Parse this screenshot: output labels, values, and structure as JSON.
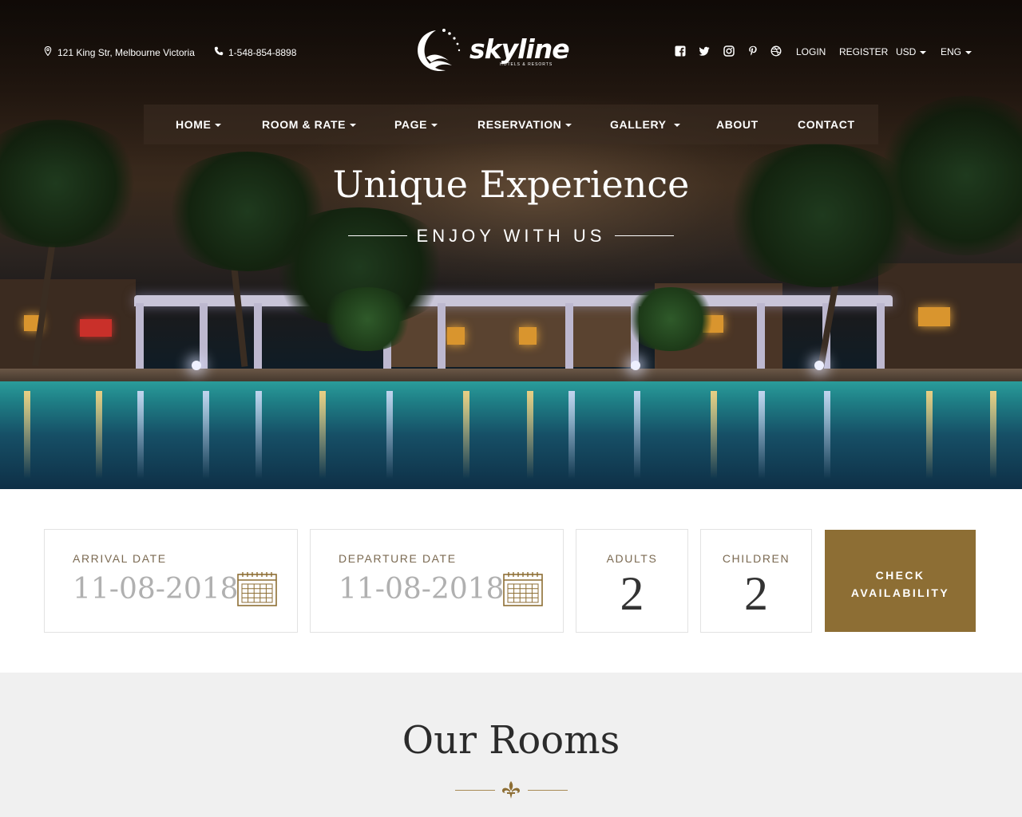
{
  "header": {
    "address": "121 King Str, Melbourne Victoria",
    "phone": "1-548-854-8898",
    "logo_text": "skyline",
    "logo_tagline": "HOTELS & RESORTS",
    "social_icons": [
      "facebook-icon",
      "twitter-icon",
      "instagram-icon",
      "pinterest-icon",
      "dribbble-icon"
    ],
    "login": "LOGIN",
    "register": "REGISTER",
    "currency": "USD",
    "language": "ENG"
  },
  "nav": {
    "items": [
      {
        "label": "HOME",
        "dropdown": true
      },
      {
        "label": "ROOM & RATE",
        "dropdown": true
      },
      {
        "label": "PAGE",
        "dropdown": true
      },
      {
        "label": "RESERVATION",
        "dropdown": true
      },
      {
        "label": "GALLERY",
        "dropdown": true
      },
      {
        "label": "ABOUT",
        "dropdown": false
      },
      {
        "label": "CONTACT",
        "dropdown": false
      }
    ]
  },
  "hero": {
    "title": "Unique Experience",
    "subtitle": "ENJOY WITH US"
  },
  "booking": {
    "arrival_label": "ARRIVAL DATE",
    "arrival_value": "11-08-2018",
    "departure_label": "DEPARTURE DATE",
    "departure_value": "11-08-2018",
    "adults_label": "ADULTS",
    "adults_value": "2",
    "children_label": "CHILDREN",
    "children_value": "2",
    "check_line1": "CHECK",
    "check_line2": "AVAILABILITY"
  },
  "rooms": {
    "title": "Our Rooms"
  },
  "colors": {
    "accent": "#8d6e34",
    "label": "#7b6a52"
  }
}
